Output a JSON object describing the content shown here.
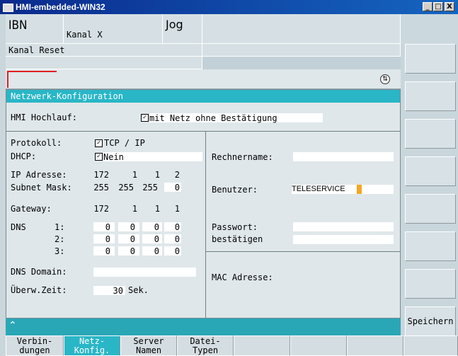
{
  "window": {
    "title": "HMI-embedded-WIN32",
    "controls": [
      "_",
      "□",
      "X"
    ]
  },
  "header": {
    "area": "IBN",
    "channel": "Kanal X",
    "mode": "Jog",
    "channel_status": "Kanal Reset"
  },
  "panel": {
    "title": "Netzwerk-Konfiguration",
    "hmi_hochlauf_label": "HMI Hochlauf:",
    "hmi_hochlauf_value": "mit Netz ohne Bestätigung",
    "protokoll_label": "Protokoll:",
    "protokoll_value": "TCP / IP",
    "dhcp_label": "DHCP:",
    "dhcp_value": "Nein",
    "ip_label": "IP Adresse:",
    "ip": [
      "172",
      "1",
      "1",
      "2"
    ],
    "subnet_label": "Subnet Mask:",
    "subnet": [
      "255",
      "255",
      "255",
      "0"
    ],
    "gateway_label": "Gateway:",
    "gateway": [
      "172",
      "1",
      "1",
      "1"
    ],
    "dns_label": "DNS",
    "dns_rows": [
      {
        "label": "1:",
        "values": [
          "0",
          "0",
          "0",
          "0"
        ]
      },
      {
        "label": "2:",
        "values": [
          "0",
          "0",
          "0",
          "0"
        ]
      },
      {
        "label": "3:",
        "values": [
          "0",
          "0",
          "0",
          "0"
        ]
      }
    ],
    "dns_domain_label": "DNS Domain:",
    "dns_domain_value": "",
    "timeout_label": "Überw.Zeit:",
    "timeout_value": "30",
    "timeout_unit": "Sek.",
    "rechnername_label": "Rechnername:",
    "rechnername_value": "",
    "benutzer_label": "Benutzer:",
    "benutzer_value": "TELESERVICE",
    "passwort_label": "Passwort:",
    "passwort_value": "",
    "bestaetigen_label": "bestätigen",
    "bestaetigen_value": "",
    "mac_label": "MAC Adresse:",
    "mac_value": ""
  },
  "right_softkeys": [
    "",
    "",
    "",
    "",
    "",
    "",
    "",
    "Speichern"
  ],
  "bottom_softkeys": [
    {
      "label": "Verbin-\ndungen",
      "active": false
    },
    {
      "label": "Netz-\nKonfig.",
      "active": true
    },
    {
      "label": "Server\nNamen",
      "active": false
    },
    {
      "label": "Datei-\nTypen",
      "active": false
    },
    {
      "label": "",
      "active": false
    },
    {
      "label": "",
      "active": false
    },
    {
      "label": "",
      "active": false
    },
    {
      "label": "",
      "active": false
    }
  ],
  "colors": {
    "accent": "#29b6c6",
    "title_bar": "#0a2a8c",
    "cursor": "#f5a623",
    "alarm_line": "#e02020"
  }
}
